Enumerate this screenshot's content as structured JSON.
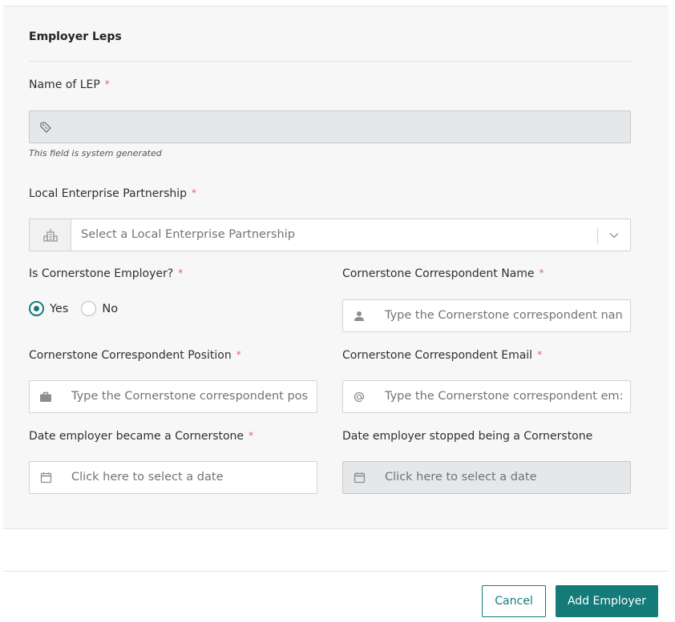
{
  "section": {
    "title": "Employer Leps"
  },
  "fields": {
    "lep_name": {
      "label": "Name of LEP",
      "required_mark": "*",
      "hint": "This field is system generated",
      "icon": "tag-icon"
    },
    "local_enterprise_partnership": {
      "label": "Local Enterprise Partnership",
      "required_mark": "*",
      "placeholder": "Select a Local Enterprise Partnership",
      "icon": "building-icon"
    },
    "is_cornerstone": {
      "label": "Is Cornerstone Employer?",
      "required_mark": "*",
      "options": [
        "Yes",
        "No"
      ],
      "selected": "Yes"
    },
    "correspondent_name": {
      "label": "Cornerstone Correspondent Name",
      "required_mark": "*",
      "placeholder": "Type the Cornerstone correspondent nan",
      "icon": "user-icon"
    },
    "correspondent_position": {
      "label": "Cornerstone Correspondent Position",
      "required_mark": "*",
      "placeholder": "Type the Cornerstone correspondent pos",
      "icon": "briefcase-icon"
    },
    "correspondent_email": {
      "label": "Cornerstone Correspondent Email",
      "required_mark": "*",
      "placeholder": "Type the Cornerstone correspondent em:",
      "icon": "at-icon"
    },
    "date_became": {
      "label": "Date employer became a Cornerstone",
      "required_mark": "*",
      "placeholder": "Click here to select a date",
      "icon": "calendar-icon"
    },
    "date_stopped": {
      "label": "Date employer stopped being a Cornerstone",
      "placeholder": "Click here to select a date",
      "icon": "calendar-icon"
    }
  },
  "actions": {
    "cancel": "Cancel",
    "submit": "Add Employer"
  },
  "colors": {
    "accent": "#137b78",
    "required": "#e06060"
  }
}
